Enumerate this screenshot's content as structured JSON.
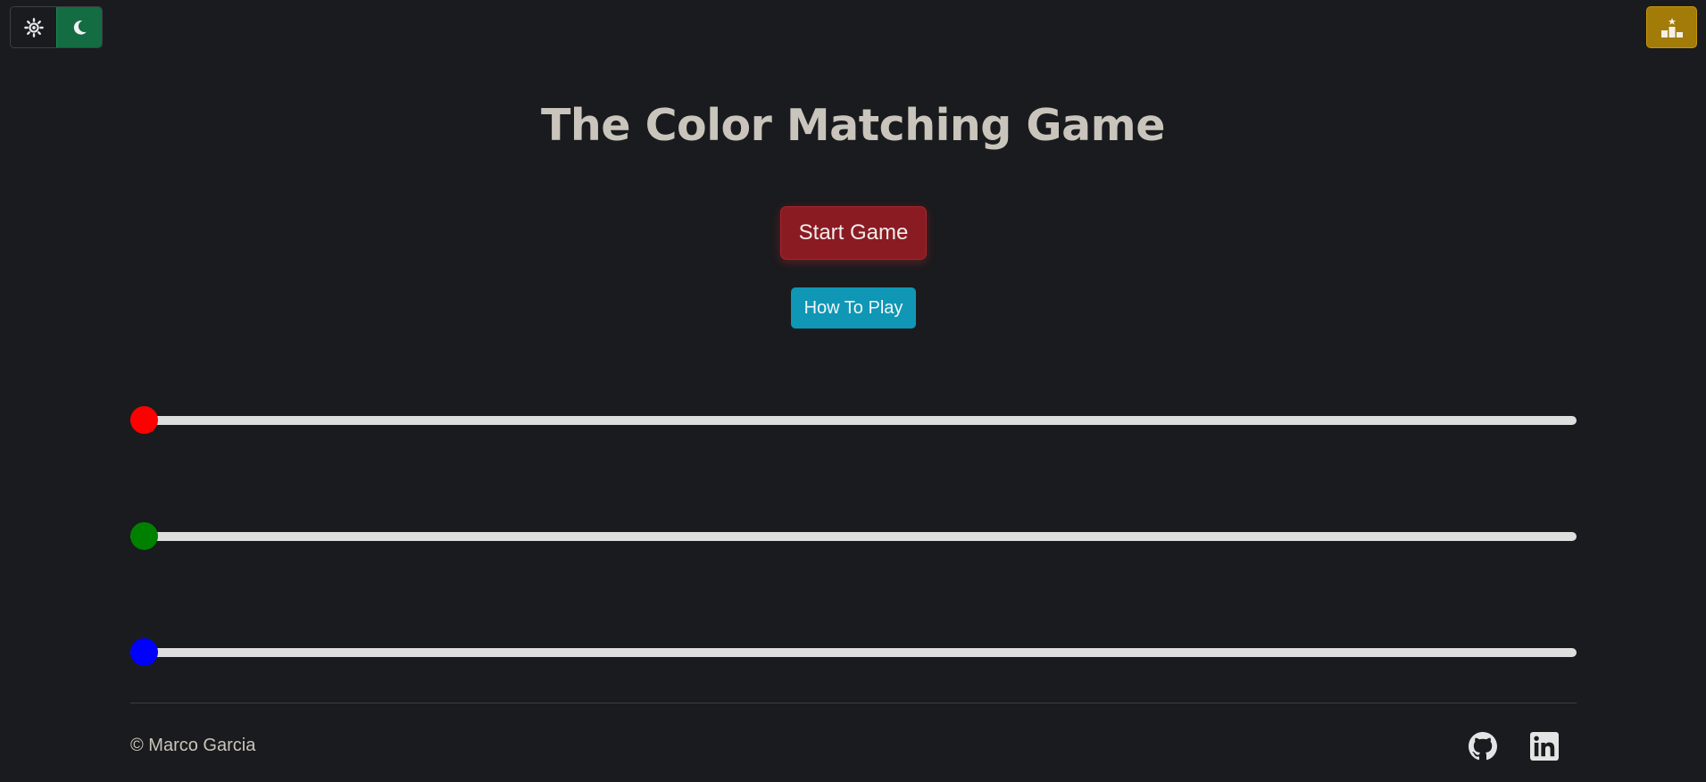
{
  "theme_toggle": {
    "light_icon": "sun-icon",
    "dark_icon": "moon-icon",
    "active": "dark",
    "active_color": "#146c43"
  },
  "leaderboard": {
    "icon": "podium-icon",
    "color": "#a27b08"
  },
  "title": "The Color Matching Game",
  "buttons": {
    "start": "Start Game",
    "start_color": "#8b1b22",
    "how_to_play": "How To Play",
    "how_to_play_color": "#0f97b5"
  },
  "sliders": [
    {
      "channel": "red",
      "color": "#ff0000",
      "value": 0
    },
    {
      "channel": "green",
      "color": "#008000",
      "value": 0
    },
    {
      "channel": "blue",
      "color": "#0000ff",
      "value": 0
    }
  ],
  "footer": {
    "copyright": "© Marco Garcia",
    "links": [
      {
        "icon": "github-icon"
      },
      {
        "icon": "linkedin-icon"
      }
    ]
  }
}
